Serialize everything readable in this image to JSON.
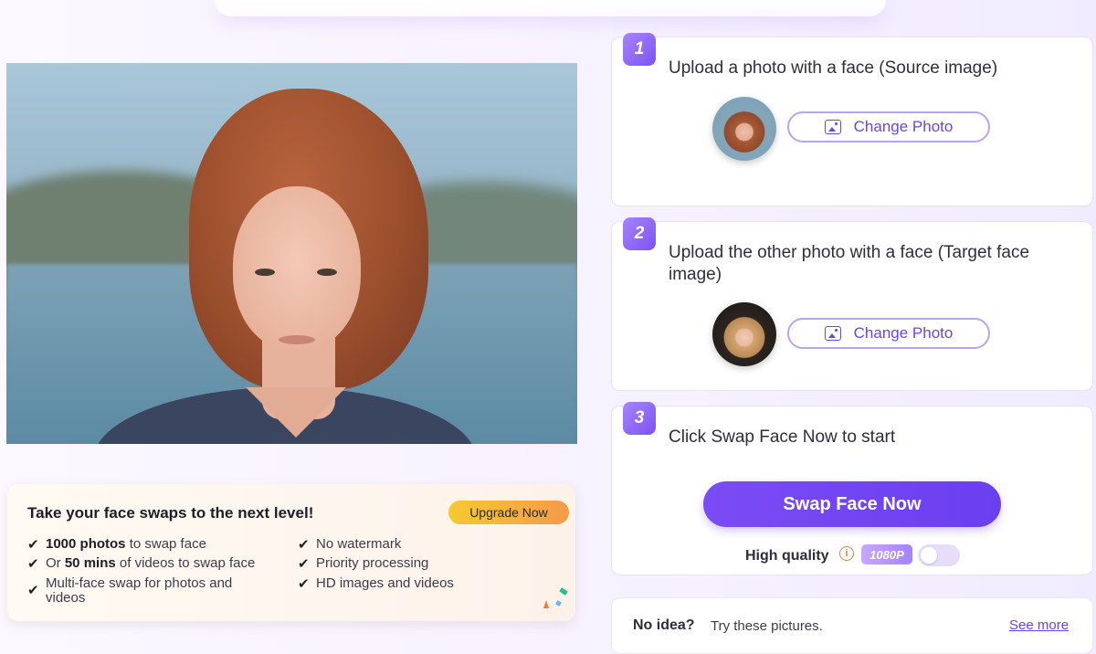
{
  "upgrade": {
    "title": "Take your face swaps to the next level!",
    "button": "Upgrade Now",
    "features_left": [
      {
        "bold": "1000 photos",
        "rest": " to swap face"
      },
      {
        "pre": "Or ",
        "bold": "50 mins",
        "rest": " of videos to swap face"
      },
      {
        "text": "Multi-face swap for photos and videos"
      }
    ],
    "features_right": [
      "No watermark",
      "Priority processing",
      "HD images and videos"
    ]
  },
  "steps": [
    {
      "number": "1",
      "text": "Upload a photo with a face (Source image)",
      "button": "Change Photo"
    },
    {
      "number": "2",
      "text": "Upload the other photo with a face (Target face image)",
      "button": "Change Photo"
    },
    {
      "number": "3",
      "text": "Click Swap Face Now to start",
      "button": "Swap Face Now"
    }
  ],
  "quality": {
    "label": "High quality",
    "info_icon": "i",
    "badge": "1080P",
    "enabled": false
  },
  "no_idea": {
    "bold": "No idea?",
    "text": "Try these pictures.",
    "link": "See more"
  },
  "colors": {
    "accent": "#6c43ea",
    "upgrade_from": "#f6c930",
    "upgrade_to": "#f59a4a"
  }
}
